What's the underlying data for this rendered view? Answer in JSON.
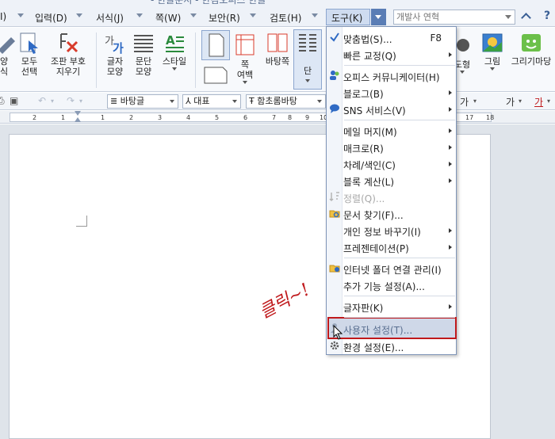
{
  "title": "- 한글문서 - 한컴오피스 한글",
  "menubar": {
    "items": [
      "입력(D)",
      "서식(J)",
      "쪽(W)",
      "보안(R)",
      "검토(H)"
    ],
    "active": "도구(K)",
    "search_placeholder": "개발사 연혁",
    "help": "?"
  },
  "ribbon": {
    "left_cut_label": "양\n식",
    "buttons": [
      {
        "label": "모두\n선택"
      },
      {
        "label": "조판 부호\n지우기"
      },
      {
        "label": "글자\n모양"
      },
      {
        "label": "문단\n모양"
      },
      {
        "label": "스타일"
      },
      {
        "label": "쪽\n여백"
      },
      {
        "label": "바탕쪽"
      },
      {
        "label": "단"
      },
      {
        "label": "도형"
      },
      {
        "label": "그림"
      },
      {
        "label": "그리기마당"
      }
    ]
  },
  "toolbar": {
    "style_combo": "바탕글",
    "lang_combo": "대표",
    "font_combo": "함초롬바탕",
    "right_glyphs": [
      "가",
      "가",
      "가"
    ]
  },
  "ruler": {
    "numbers": [
      "2",
      "1",
      "1",
      "2",
      "3",
      "4",
      "5",
      "6",
      "7",
      "8",
      "9",
      "10",
      "11",
      "17",
      "18"
    ]
  },
  "annotation": "클릭~!",
  "dropdown": {
    "items": [
      {
        "label": "맞춤법(S)...",
        "shortcut": "F8",
        "submenu": false,
        "icon": "spellcheck-icon",
        "disabled": false
      },
      {
        "label": "빠른 교정(Q)",
        "shortcut": "",
        "submenu": true,
        "icon": "",
        "disabled": false
      },
      {
        "label": "오피스 커뮤니케이터(H)",
        "shortcut": "",
        "submenu": false,
        "icon": "communicator-icon",
        "disabled": false
      },
      {
        "label": "블로그(B)",
        "shortcut": "",
        "submenu": true,
        "icon": "",
        "disabled": false
      },
      {
        "label": "SNS 서비스(V)",
        "shortcut": "",
        "submenu": true,
        "icon": "sns-icon",
        "disabled": false
      },
      {
        "label": "메일 머지(M)",
        "shortcut": "",
        "submenu": true,
        "icon": "",
        "disabled": false
      },
      {
        "label": "매크로(R)",
        "shortcut": "",
        "submenu": true,
        "icon": "",
        "disabled": false
      },
      {
        "label": "차례/색인(C)",
        "shortcut": "",
        "submenu": true,
        "icon": "",
        "disabled": false
      },
      {
        "label": "블록 계산(L)",
        "shortcut": "",
        "submenu": true,
        "icon": "",
        "disabled": false
      },
      {
        "label": "정렬(Q)...",
        "shortcut": "",
        "submenu": false,
        "icon": "sort-icon",
        "disabled": true
      },
      {
        "label": "문서 찾기(F)...",
        "shortcut": "",
        "submenu": false,
        "icon": "find-doc-icon",
        "disabled": false
      },
      {
        "label": "개인 정보 바꾸기(I)",
        "shortcut": "",
        "submenu": true,
        "icon": "",
        "disabled": false
      },
      {
        "label": "프레젠테이션(P)",
        "shortcut": "",
        "submenu": true,
        "icon": "",
        "disabled": false
      },
      {
        "label": "인터넷 폴더 연결 관리(I)",
        "shortcut": "",
        "submenu": false,
        "icon": "internet-folder-icon",
        "disabled": false
      },
      {
        "label": "추가 기능 설정(A)...",
        "shortcut": "",
        "submenu": false,
        "icon": "",
        "disabled": false
      },
      {
        "label": "글자판(K)",
        "shortcut": "",
        "submenu": true,
        "icon": "",
        "disabled": false
      },
      {
        "label": "사용자 설정(T)...",
        "shortcut": "",
        "submenu": false,
        "icon": "user-settings-icon",
        "disabled": false
      },
      {
        "label": "환경 설정(E)...",
        "shortcut": "",
        "submenu": false,
        "icon": "gear-icon",
        "disabled": false
      }
    ]
  }
}
